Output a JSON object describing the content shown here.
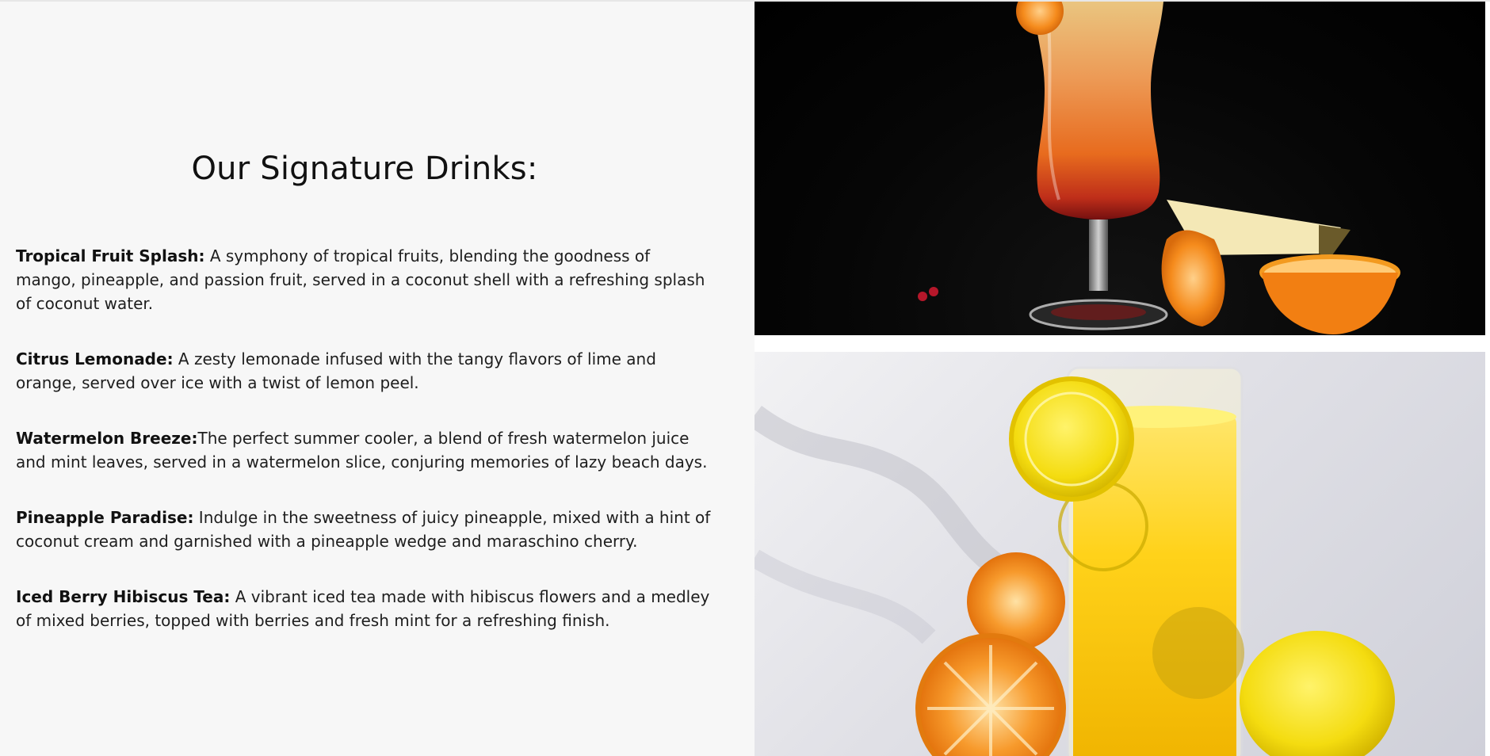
{
  "section": {
    "title": "Our Signature Drinks:"
  },
  "drinks": [
    {
      "name": "Tropical Fruit Splash:",
      "description": " A symphony of tropical fruits, blending the goodness of mango, pineapple, and passion fruit, served in a coconut shell with a refreshing splash of coconut water."
    },
    {
      "name": "Citrus Lemonade:",
      "description": " A zesty lemonade infused with the tangy flavors of lime and orange, served over ice with a twist of lemon peel."
    },
    {
      "name": "Watermelon Breeze:",
      "description": "The perfect summer cooler, a blend of fresh watermelon juice and mint leaves, served in a watermelon slice, conjuring memories of lazy beach days."
    },
    {
      "name": "Pineapple Paradise:",
      "description": " Indulge in the sweetness of juicy pineapple, mixed with a hint of coconut cream and garnished with a pineapple wedge and maraschino cherry."
    },
    {
      "name": "Iced Berry Hibiscus Tea:",
      "description": " A vibrant iced tea made with hibiscus flowers and a medley of mixed berries, topped with berries and fresh mint for a refreshing finish."
    }
  ],
  "colors": {
    "panel_background": "#f7f7f7",
    "text": "#1e1e1e",
    "orange": "#f08a1c",
    "lemon": "#f5d90a"
  }
}
